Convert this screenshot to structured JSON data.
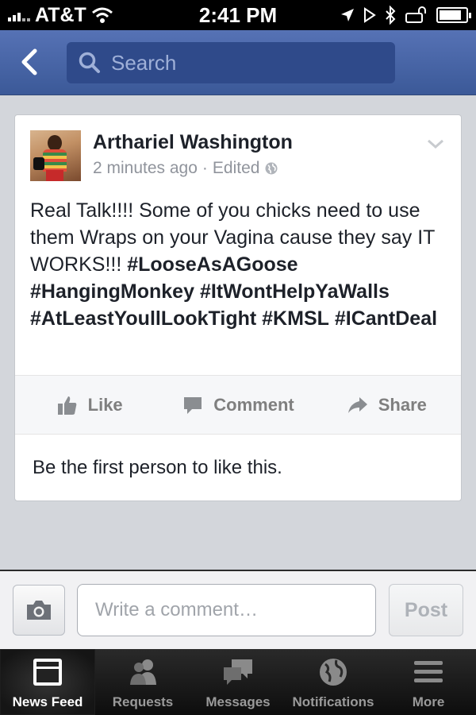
{
  "status_bar": {
    "carrier": "AT&T",
    "time": "2:41 PM",
    "icons": [
      "signal-icon",
      "wifi-icon",
      "location-icon",
      "play-icon",
      "bluetooth-icon",
      "lock-rotation-icon",
      "battery-icon"
    ],
    "battery_level": 0.85
  },
  "nav": {
    "back_icon": "chevron-left-icon",
    "search_placeholder": "Search"
  },
  "post": {
    "author": "Arthariel Washington",
    "time": "2 minutes ago",
    "separator": "·",
    "edited": "Edited",
    "privacy_icon": "globe-icon",
    "text_plain": "Real Talk!!!! Some of you chicks need to use them Wraps on your Vagina cause they say IT WORKS!!! ",
    "hashtags": [
      "#LooseAsAGoose",
      "#HangingMonkey",
      "#ItWontHelpYaWalls",
      "#AtLeastYoullLookTight",
      "#KMSL",
      "#ICantDeal"
    ],
    "actions": {
      "like": "Like",
      "comment": "Comment",
      "share": "Share"
    },
    "likes_line": "Be the first person to like this."
  },
  "comment_bar": {
    "placeholder": "Write a comment…",
    "post_label": "Post"
  },
  "tab_bar": {
    "tabs": [
      {
        "label": "News Feed",
        "icon": "news-feed-icon",
        "active": true
      },
      {
        "label": "Requests",
        "icon": "friends-icon",
        "active": false
      },
      {
        "label": "Messages",
        "icon": "messages-icon",
        "active": false
      },
      {
        "label": "Notifications",
        "icon": "globe-icon",
        "active": false
      },
      {
        "label": "More",
        "icon": "menu-icon",
        "active": false
      }
    ]
  },
  "colors": {
    "brand_blue": "#3b5998",
    "feed_background": "#d3d6db"
  }
}
